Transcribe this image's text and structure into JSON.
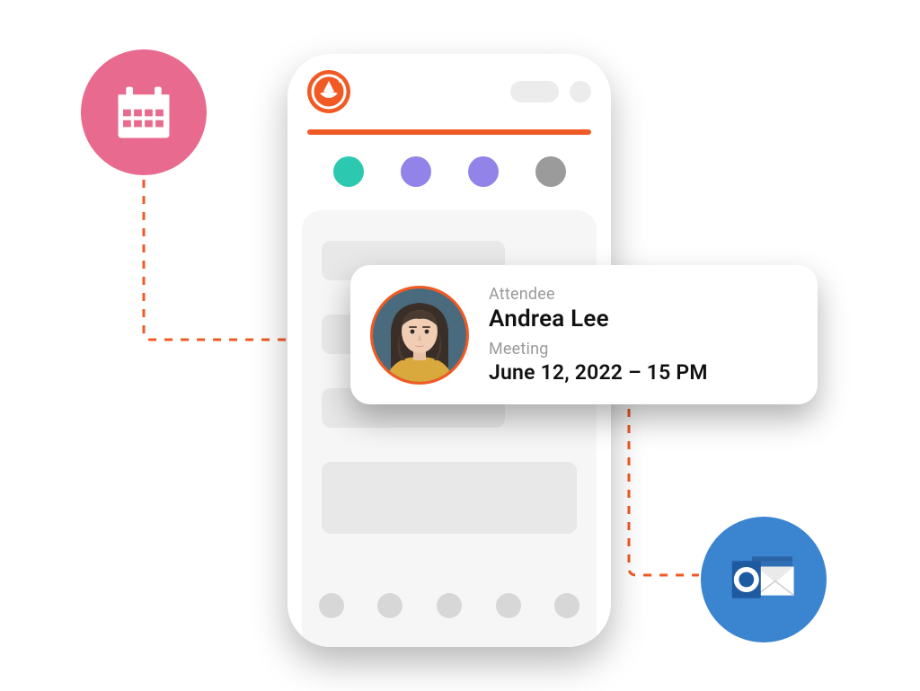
{
  "colors": {
    "accent": "#f15a24",
    "pink": "#e86a8e",
    "blue": "#3b84d0",
    "teal": "#2cc9b0",
    "purple": "#9183e8",
    "gray": "#9b9b9b"
  },
  "calendar_badge": {
    "icon": "calendar-icon"
  },
  "outlook_badge": {
    "icon": "outlook-icon"
  },
  "phone": {
    "status_dots": [
      "teal",
      "purple",
      "purple",
      "gray"
    ],
    "skeletons": [
      "small",
      "small",
      "small",
      "large"
    ],
    "bottom_nav_count": 5
  },
  "attendee_card": {
    "attendee_label": "Attendee",
    "attendee_name": "Andrea Lee",
    "meeting_label": "Meeting",
    "meeting_time": "June 12, 2022 – 15 PM"
  }
}
